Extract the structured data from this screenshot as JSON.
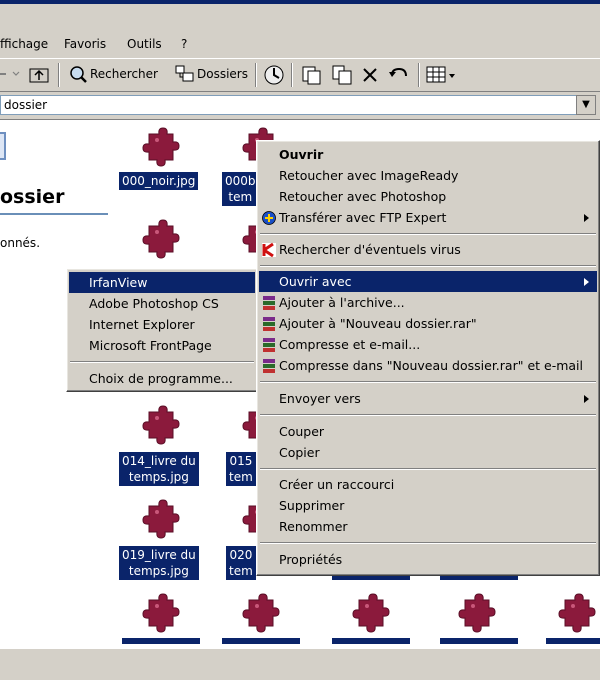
{
  "menubar": {
    "items": [
      "ffichage",
      "Favoris",
      "Outils",
      "?"
    ]
  },
  "toolbar": {
    "search_label": "Rechercher",
    "folders_label": "Dossiers"
  },
  "address": {
    "value": "dossier"
  },
  "left_pane": {
    "heading": "ossier",
    "text": "onnés."
  },
  "files": [
    {
      "label": "000_noir.jpg"
    },
    {
      "label": "000b\ntem"
    },
    {
      "label": "014_livre du\ntemps.jpg"
    },
    {
      "label": "015\ntem"
    },
    {
      "label": "019_livre du\ntemps.jpg"
    },
    {
      "label": "020\ntem"
    }
  ],
  "context_menu": {
    "open": "Ouvrir",
    "retouch_imageready": "Retoucher avec ImageReady",
    "retouch_photoshop": "Retoucher avec Photoshop",
    "transfer_ftp": "Transférer avec FTP Expert",
    "virus_scan": "Rechercher d'éventuels virus",
    "open_with": "Ouvrir avec",
    "add_archive": "Ajouter à l'archive...",
    "add_rar": "Ajouter à \"Nouveau dossier.rar\"",
    "compress_email": "Compresse et e-mail...",
    "compress_rar_email": "Compresse dans \"Nouveau dossier.rar\" et e-mail",
    "send_to": "Envoyer vers",
    "cut": "Couper",
    "copy": "Copier",
    "create_shortcut": "Créer un raccourci",
    "delete": "Supprimer",
    "rename": "Renommer",
    "properties": "Propriétés"
  },
  "open_with_menu": {
    "items": [
      "IrfanView",
      "Adobe Photoshop CS",
      "Internet Explorer",
      "Microsoft FrontPage"
    ],
    "choose": "Choix de programme..."
  },
  "colors": {
    "selection": "#0a246a",
    "menu_bg": "#d4d0c8",
    "puzzle": "#8b1a3c"
  }
}
